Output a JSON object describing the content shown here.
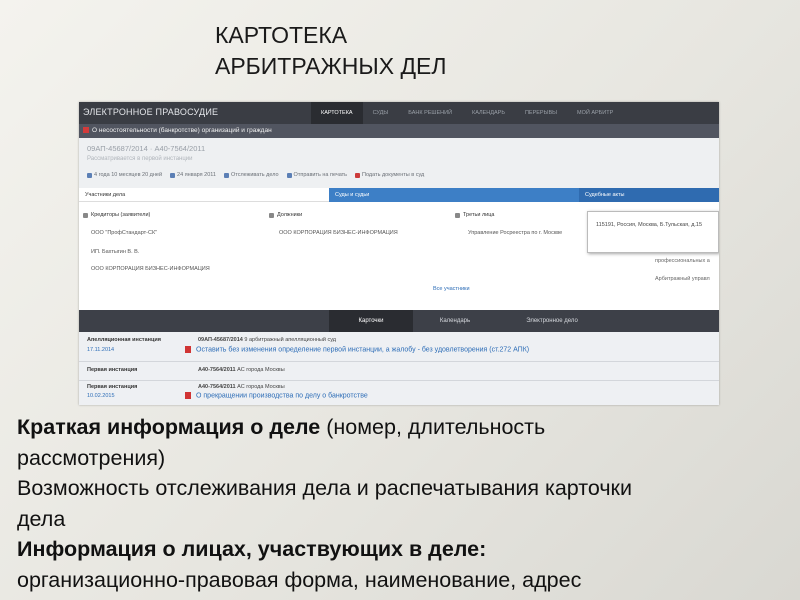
{
  "slide": {
    "title_line1": "КАРТОТЕКА",
    "title_line2": "АРБИТРАЖНЫХ ДЕЛ"
  },
  "portal": {
    "brand": "ЭЛЕКТРОННОЕ ПРАВОСУДИЕ",
    "nav": [
      {
        "label": "Картотека",
        "active": true
      },
      {
        "label": "Суды",
        "active": false
      },
      {
        "label": "Банк решений",
        "active": false
      },
      {
        "label": "Календарь",
        "active": false
      },
      {
        "label": "Перерывы",
        "active": false
      },
      {
        "label": "Мой арбитр",
        "active": false
      }
    ],
    "category": "О несостоятельности (банкротстве) организаций и граждан",
    "case_number": "09АП-45687/2014 · А40-7564/2011",
    "case_status": "Рассматривается в первой инстанции",
    "actions": {
      "duration": "4 года 10 месяцев 20 дней",
      "date": "24 января 2011",
      "track": "Отслеживать дело",
      "print": "Отправить на печать",
      "submit": "Подать документы в суд"
    },
    "tabs": [
      "Участники дела",
      "Суды и судьи",
      "Судебные акты"
    ],
    "participants": {
      "creditors_title": "Кредиторы (заявители)",
      "creditors": [
        "ООО \"ПрофСтандарт-СК\"",
        "ИП. Бахтыгин В. В.",
        "ООО КОРПОРАЦИЯ БИЗНЕС-ИНФОРМАЦИЯ"
      ],
      "debtors_title": "Должники",
      "debtors": [
        "ООО КОРПОРАЦИЯ БИЗНЕС-ИНФОРМАЦИЯ"
      ],
      "third_title": "Третьи лица",
      "third": [
        "Управление Росреестра по г. Москве"
      ],
      "all_link": "Все участники"
    },
    "tooltip": "115191, Россия, Москва, Б.Тульская, д.15",
    "right_tail": [
      "профессиональных а",
      "Арбитражный управл"
    ],
    "bottom_tabs": [
      "Карточки",
      "Календарь",
      "Электронное дело"
    ],
    "events": [
      {
        "kind": "Апелляционная инстанция",
        "date": "17.11.2014",
        "case": "09АП-45687/2014",
        "court": "9 арбитражный апелляционный суд",
        "link": "Оставить без изменения определение первой инстанции, а жалобу - без удовлетворения (ст.272 АПК)"
      },
      {
        "kind": "Первая инстанция",
        "date": "",
        "case": "А40-7564/2011",
        "court": "АС города Москвы",
        "link": ""
      },
      {
        "kind": "Первая инстанция",
        "date": "10.02.2015",
        "case": "А40-7564/2011",
        "court": "АС города Москвы",
        "link": "О прекращении производства по делу о банкротстве"
      }
    ]
  },
  "bullets": {
    "b1_bold": "Краткая информация о деле",
    "b1_rest": " (номер, длительность",
    "b1_line2": "рассмотрения)",
    "b2_line1": "Возможность отслеживания дела и распечатывания карточки",
    "b2_line2": "дела",
    "b3_bold": "Информация о лицах, участвующих в деле:",
    "b3_line2": "организационно-правовая форма, наименование, адрес"
  }
}
